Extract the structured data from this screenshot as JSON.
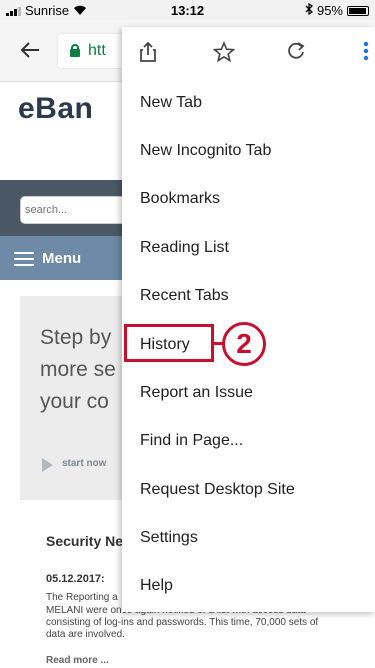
{
  "status_bar": {
    "carrier": "Sunrise",
    "time": "13:12",
    "battery": "95%"
  },
  "browser": {
    "url_text": "htt",
    "icons": [
      "back-arrow-icon",
      "lock-icon",
      "share-icon",
      "star-icon",
      "reload-icon",
      "more-vert-icon"
    ]
  },
  "page": {
    "logo": "eBan",
    "search_placeholder": "search...",
    "menu_label": "Menu",
    "promo_title": "Step by\nmore se\nyour co",
    "start_link": "start now",
    "news": {
      "title": "Security Ne",
      "date": "05.12.2017:",
      "body_fragment": "The Reporting a",
      "body_lines": [
        "MELANI were once again notified of a list with access data",
        "consisting of log-ins and passwords. This time, 70,000 sets of",
        "data are involved."
      ],
      "read_more": "Read more ..."
    }
  },
  "overflow_menu": {
    "items": [
      "New Tab",
      "New Incognito Tab",
      "Bookmarks",
      "Reading List",
      "Recent Tabs",
      "History",
      "Report an Issue",
      "Find in Page...",
      "Request Desktop Site",
      "Settings",
      "Help"
    ],
    "highlighted_item": "History"
  },
  "annotation": {
    "step_number": "2",
    "color": "#c8102e"
  },
  "colors": {
    "accent_green": "#0b8043",
    "menu_band": "#6f8aa6",
    "dark_band": "#4a5866"
  }
}
